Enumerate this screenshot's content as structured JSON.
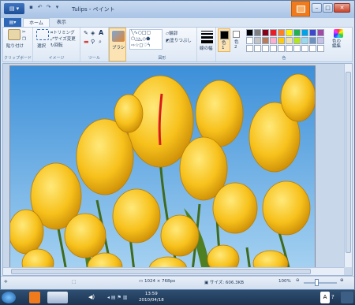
{
  "window": {
    "title": "Tulips - ペイント"
  },
  "tabs": [
    {
      "label": ""
    },
    {
      "label": "ホーム"
    },
    {
      "label": "表示"
    }
  ],
  "ribbon": {
    "clipboard": {
      "paste_label": "貼り付け",
      "group_label": "クリップボード"
    },
    "image": {
      "select_label": "選択",
      "crop_label": "トリミング",
      "resize_label": "サイズ変更",
      "rotate_label": "回転",
      "group_label": "イメージ"
    },
    "tools": {
      "group_label": "ツール"
    },
    "brushes": {
      "label": "ブラシ"
    },
    "shapes": {
      "outline_label": "輪郭",
      "fill_label": "塗りつぶし",
      "group_label": "図形"
    },
    "size": {
      "label": "線の幅"
    },
    "colors": {
      "color1_label": "色\n1",
      "color2_label": "色\n2",
      "edit_label": "色の\n編集",
      "group_label": "色"
    }
  },
  "palette": [
    "#000000",
    "#7f7f7f",
    "#880015",
    "#ed1c24",
    "#ff7f27",
    "#fff200",
    "#22b14c",
    "#00a2e8",
    "#3f48cc",
    "#a349a4",
    "#ffffff",
    "#c3c3c3",
    "#b97a57",
    "#ffaec9",
    "#ffc90e",
    "#efe4b0",
    "#b5e61d",
    "#99d9ea",
    "#7092be",
    "#c8bfe7"
  ],
  "colors_state": {
    "color1": "#000000",
    "color2": "#ffffff"
  },
  "status": {
    "dimensions": "1024 × 768px",
    "size": "サイズ: 606.3KB",
    "zoom": "100%"
  },
  "taskbar": {
    "time": "13:59",
    "date": "2010/04/18"
  }
}
